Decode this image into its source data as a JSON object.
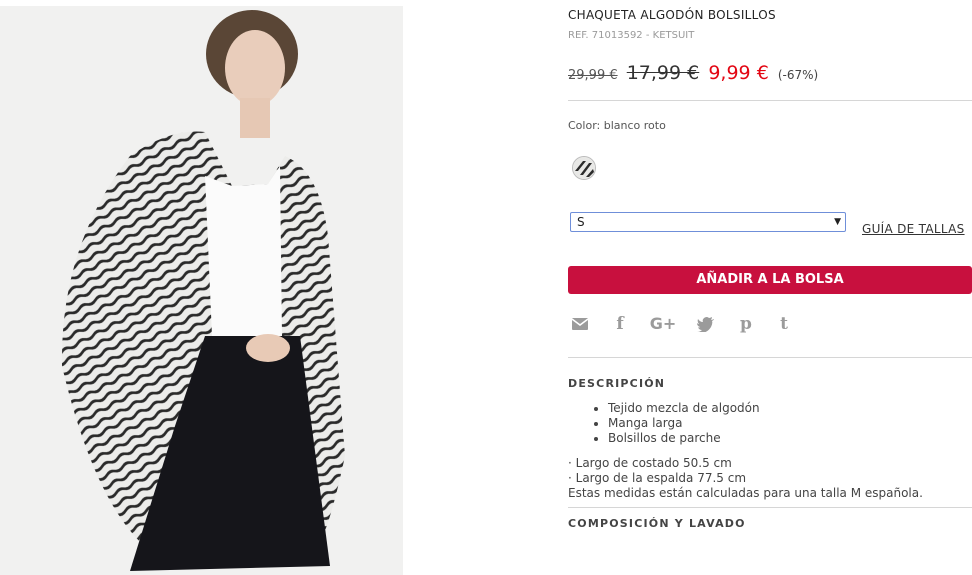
{
  "product": {
    "title": "CHAQUETA ALGODÓN BOLSILLOS",
    "ref": "REF. 71013592 - KETSUIT",
    "price_original": "29,99 €",
    "price_previous": "17,99 €",
    "price_current": "9,99 €",
    "discount": "(-67%)"
  },
  "color": {
    "label": "Color: blanco roto",
    "swatch_icon": "zebra-print-swatch-icon"
  },
  "size": {
    "selected": "S",
    "guide_label": "GUÍA DE TALLAS"
  },
  "cart": {
    "add_label": "AÑADIR A LA BOLSA"
  },
  "share": {
    "icons": [
      "mail-icon",
      "facebook-icon",
      "google-plus-icon",
      "twitter-icon",
      "pinterest-icon",
      "tumblr-icon"
    ]
  },
  "description": {
    "heading": "DESCRIPCIÓN",
    "bullets": [
      "Tejido mezcla de algodón",
      "Manga larga",
      "Bolsillos de parche"
    ],
    "measures": [
      "· Largo de costado 50.5 cm",
      "· Largo de la espalda 77.5 cm",
      "Estas medidas están calculadas para una talla M española."
    ]
  },
  "composition": {
    "heading": "COMPOSICIÓN Y LAVADO"
  },
  "colors": {
    "accent_button": "#c8103e",
    "sale_price": "#e30613"
  }
}
